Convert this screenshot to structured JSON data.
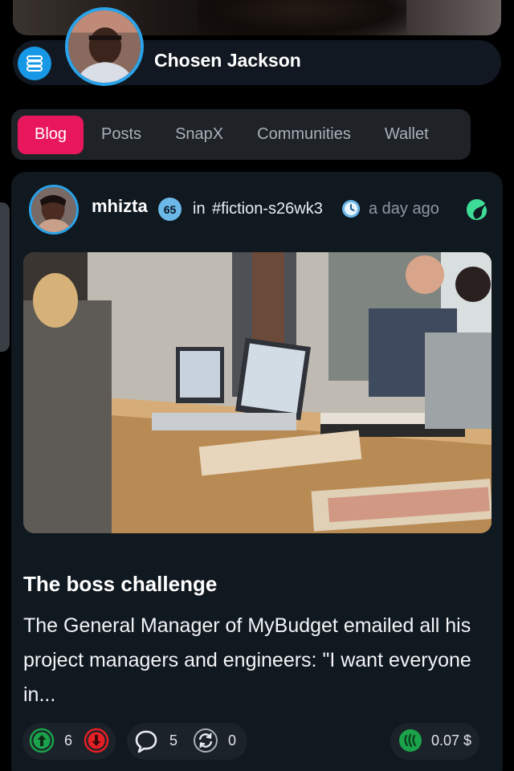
{
  "profile": {
    "name": "Chosen Jackson"
  },
  "tabs": [
    {
      "label": "Blog",
      "active": true
    },
    {
      "label": "Posts",
      "active": false
    },
    {
      "label": "SnapX",
      "active": false
    },
    {
      "label": "Communities",
      "active": false
    },
    {
      "label": "Wallet",
      "active": false
    }
  ],
  "post": {
    "author": "mhizta",
    "reputation": "65",
    "in_label": "in",
    "community": "#fiction-s26wk3",
    "time": "a day ago",
    "title": "The boss challenge",
    "excerpt": "The General Manager of MyBudget emailed all his project managers and engineers: \"I want everyone in...",
    "upvotes": "6",
    "comments": "5",
    "resteems": "0",
    "payout": "0.07 $"
  },
  "icons": {
    "menu": "menu-icon",
    "clock": "clock-icon",
    "steem": "steem-logo-icon",
    "upvote": "upvote-icon",
    "downvote": "downvote-icon",
    "comment": "comment-icon",
    "resteem": "resteem-icon",
    "payout": "steem-coin-icon"
  },
  "colors": {
    "accent_blue": "#2aa3ea",
    "tab_active": "#e8175d",
    "upvote_green": "#1aa34a",
    "downvote_red": "#e41f25",
    "steem_green": "#3ddc97",
    "card_bg": "#101820"
  }
}
